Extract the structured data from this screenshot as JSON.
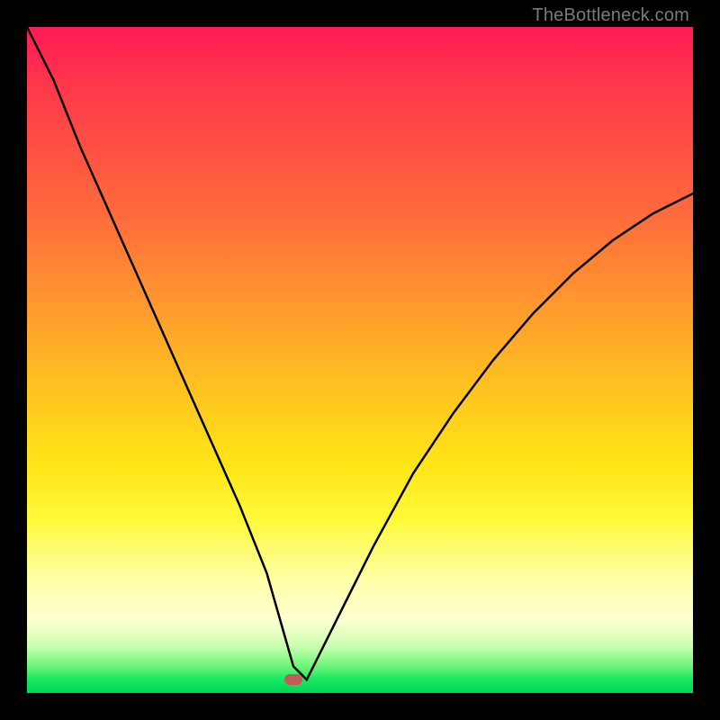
{
  "watermark": {
    "text": "TheBottleneck.com"
  },
  "colors": {
    "frame": "#000000",
    "curve": "#000000",
    "marker": "#c45a5a",
    "gradient_top": "#ff1a55",
    "gradient_bottom": "#00d45a"
  },
  "chart_data": {
    "type": "line",
    "title": "",
    "xlabel": "",
    "ylabel": "",
    "xlim": [
      0,
      100
    ],
    "ylim": [
      0,
      100
    ],
    "grid": false,
    "legend": false,
    "marker": {
      "x": 40,
      "y": 2
    },
    "series": [
      {
        "name": "bottleneck-curve",
        "x": [
          0,
          4,
          8,
          12,
          16,
          20,
          24,
          28,
          32,
          36,
          38,
          40,
          42,
          43,
          47,
          52,
          58,
          64,
          70,
          76,
          82,
          88,
          94,
          100
        ],
        "values": [
          100,
          92,
          82,
          73,
          64,
          55,
          46,
          37,
          28,
          18,
          11,
          4,
          2,
          4,
          12,
          22,
          33,
          42,
          50,
          57,
          63,
          68,
          72,
          75
        ]
      }
    ]
  }
}
